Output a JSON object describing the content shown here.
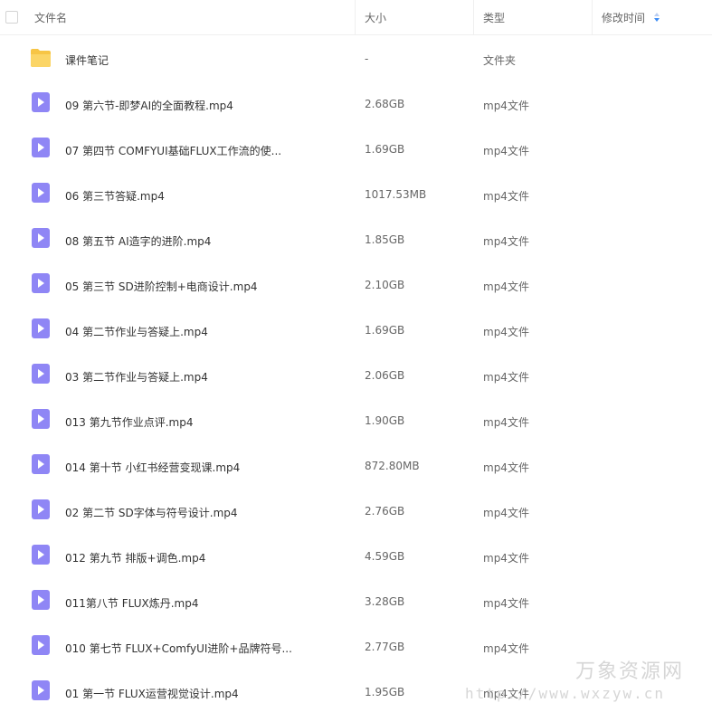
{
  "header": {
    "name_label": "文件名",
    "size_label": "大小",
    "type_label": "类型",
    "modified_label": "修改时间"
  },
  "colors": {
    "folder": "#f7c545",
    "video_icon": "#8f86f5",
    "header_text": "#666666",
    "text": "#333333",
    "sort_active": "#3d8cf5"
  },
  "files": [
    {
      "name": "课件笔记",
      "size": "-",
      "type": "文件夹",
      "icon": "folder-icon"
    },
    {
      "name": "09 第六节-即梦AI的全面教程.mp4",
      "size": "2.68GB",
      "type": "mp4文件",
      "icon": "video-file-icon"
    },
    {
      "name": "07 第四节 COMFYUI基础FLUX工作流的使...",
      "size": "1.69GB",
      "type": "mp4文件",
      "icon": "video-file-icon"
    },
    {
      "name": "06 第三节答疑.mp4",
      "size": "1017.53MB",
      "type": "mp4文件",
      "icon": "video-file-icon"
    },
    {
      "name": "08 第五节 AI造字的进阶.mp4",
      "size": "1.85GB",
      "type": "mp4文件",
      "icon": "video-file-icon"
    },
    {
      "name": "05 第三节 SD进阶控制+电商设计.mp4",
      "size": "2.10GB",
      "type": "mp4文件",
      "icon": "video-file-icon"
    },
    {
      "name": "04 第二节作业与答疑上.mp4",
      "size": "1.69GB",
      "type": "mp4文件",
      "icon": "video-file-icon"
    },
    {
      "name": "03 第二节作业与答疑上.mp4",
      "size": "2.06GB",
      "type": "mp4文件",
      "icon": "video-file-icon"
    },
    {
      "name": "013 第九节作业点评.mp4",
      "size": "1.90GB",
      "type": "mp4文件",
      "icon": "video-file-icon"
    },
    {
      "name": "014 第十节 小红书经营变现课.mp4",
      "size": "872.80MB",
      "type": "mp4文件",
      "icon": "video-file-icon"
    },
    {
      "name": "02 第二节 SD字体与符号设计.mp4",
      "size": "2.76GB",
      "type": "mp4文件",
      "icon": "video-file-icon"
    },
    {
      "name": "012 第九节 排版+调色.mp4",
      "size": "4.59GB",
      "type": "mp4文件",
      "icon": "video-file-icon"
    },
    {
      "name": "011第八节 FLUX炼丹.mp4",
      "size": "3.28GB",
      "type": "mp4文件",
      "icon": "video-file-icon"
    },
    {
      "name": "010 第七节 FLUX+ComfyUI进阶+品牌符号...",
      "size": "2.77GB",
      "type": "mp4文件",
      "icon": "video-file-icon"
    },
    {
      "name": "01 第一节 FLUX运营视觉设计.mp4",
      "size": "1.95GB",
      "type": "mp4文件",
      "icon": "video-file-icon"
    }
  ],
  "watermark": {
    "title": "万象资源网",
    "url": "http://www.wxzyw.cn"
  }
}
